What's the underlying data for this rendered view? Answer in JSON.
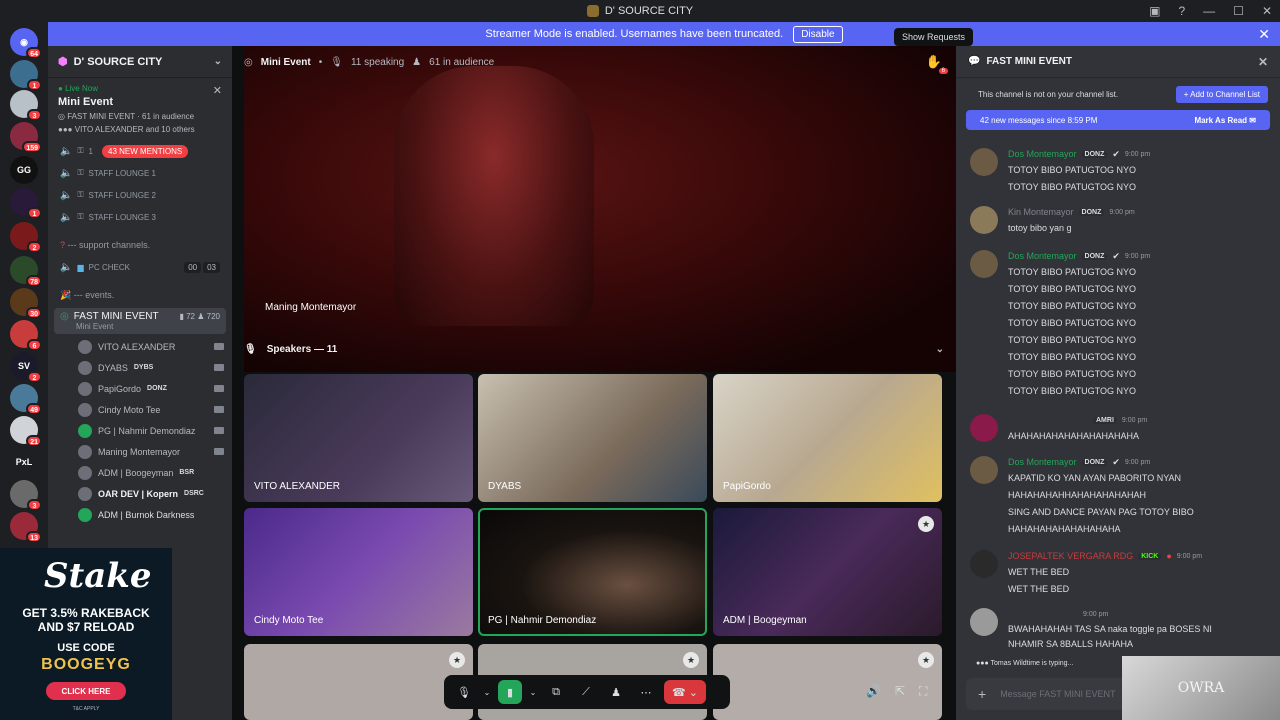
{
  "window": {
    "title": "D' SOURCE CITY"
  },
  "banner": {
    "text": "Streamer Mode is enabled. Usernames have been truncated.",
    "button": "Disable"
  },
  "tooltip": "Show Requests",
  "rail": {
    "guilds": [
      {
        "badge": "64",
        "text": ""
      },
      {
        "badge": "1",
        "text": ""
      },
      {
        "badge": "3",
        "text": ""
      },
      {
        "badge": "159",
        "text": ""
      },
      {
        "badge": "",
        "text": "GG"
      },
      {
        "badge": "1",
        "text": ""
      },
      {
        "badge": "2",
        "text": ""
      },
      {
        "badge": "78",
        "text": ""
      },
      {
        "badge": "30",
        "text": ""
      },
      {
        "badge": "6",
        "text": ""
      },
      {
        "badge": "2",
        "text": "SV"
      },
      {
        "badge": "49",
        "text": ""
      },
      {
        "badge": "21",
        "text": ""
      },
      {
        "badge": "",
        "text": "PxL"
      },
      {
        "badge": "3",
        "text": ""
      },
      {
        "badge": "13",
        "text": ""
      }
    ]
  },
  "sidebar": {
    "server_name": "D' SOURCE CITY",
    "live": {
      "status": "Live Now",
      "event": "Mini Event",
      "channel": "FAST MINI EVENT",
      "audience": "61 in audience",
      "attendees": "VITO ALEXANDER and 10 others"
    },
    "channels": [
      {
        "name": "1",
        "pill": "43 NEW MENTIONS"
      },
      {
        "name": "STAFF LOUNGE 1",
        "pill": ""
      },
      {
        "name": "STAFF LOUNGE 2",
        "pill": ""
      },
      {
        "name": "STAFF LOUNGE 3",
        "pill": ""
      }
    ],
    "support_category": "--- support channels.",
    "pc_check": {
      "name": "PC CHECK",
      "counts": [
        "00",
        "03"
      ]
    },
    "events_category": "--- events.",
    "stage_channel": {
      "name": "FAST MINI EVENT",
      "subtitle": "Mini Event",
      "cams": "72",
      "listeners": "720"
    },
    "members": [
      {
        "name": "VITO ALEXANDER",
        "tag": ""
      },
      {
        "name": "DYABS",
        "tag": "DYBS"
      },
      {
        "name": "PapiGordo",
        "tag": "DONZ"
      },
      {
        "name": "Cindy Moto Tee",
        "tag": ""
      },
      {
        "name": "PG | Nahmir Demondiaz",
        "tag": ""
      },
      {
        "name": "Maning Montemayor",
        "tag": ""
      },
      {
        "name": "ADM | Boogeyman",
        "tag": "BSR"
      },
      {
        "name": "OAR DEV | Kopern",
        "tag": "DSRC"
      },
      {
        "name": "ADM | Burnok Darkness",
        "tag": ""
      }
    ]
  },
  "ad": {
    "brand": "Stake",
    "line1": "GET 3.5% RAKEBACK",
    "line2": "AND $7 RELOAD",
    "line3": "USE CODE",
    "code": "BOOGEYG",
    "cta": "CLICK HERE",
    "fine": "T&C APPLY"
  },
  "stage": {
    "name": "Mini Event",
    "speaking": "11 speaking",
    "audience": "61 in audience",
    "hand_count": "6",
    "main_label": "Maning Montemayor",
    "speakers_label": "Speakers — 11",
    "tiles": [
      {
        "label": "VITO ALEXANDER"
      },
      {
        "label": "DYABS"
      },
      {
        "label": "PapiGordo"
      },
      {
        "label": "Cindy Moto Tee"
      },
      {
        "label": "PG | Nahmir Demondiaz"
      },
      {
        "label": "ADM | Boogeyman"
      },
      {
        "label": ""
      },
      {
        "label": ""
      },
      {
        "label": ""
      }
    ]
  },
  "chat": {
    "title": "FAST MINI EVENT",
    "notice": "This channel is not on your channel list.",
    "add_button": "Add to Channel List",
    "new_messages": "42 new messages since 8:59 PM",
    "mark_read": "Mark As Read",
    "messages": [
      {
        "name": "Dos Montemayor",
        "tag": "DONZ",
        "time": "9:00 pm",
        "style": "green",
        "lines": [
          "TOTOY BIBO PATUGTOG NYO",
          "TOTOY BIBO PATUGTOG NYO"
        ]
      },
      {
        "name": "Kin Montemayor",
        "tag": "DONZ",
        "time": "9:00 pm",
        "style": "dim",
        "lines": [
          "totoy bibo yan g"
        ]
      },
      {
        "name": "Dos Montemayor",
        "tag": "DONZ",
        "time": "9:00 pm",
        "style": "green",
        "lines": [
          "TOTOY BIBO PATUGTOG NYO",
          "TOTOY BIBO PATUGTOG NYO",
          "TOTOY BIBO PATUGTOG NYO",
          "TOTOY BIBO PATUGTOG NYO",
          "TOTOY BIBO PATUGTOG NYO",
          "TOTOY BIBO PATUGTOG NYO",
          "TOTOY BIBO PATUGTOG NYO",
          "TOTOY BIBO PATUGTOG NYO"
        ]
      },
      {
        "name": "",
        "tag": "AMRI",
        "time": "9:00 pm",
        "style": "dim",
        "lines": [
          "AHAHAHAHAHAHAHAHAHAHA"
        ]
      },
      {
        "name": "Dos Montemayor",
        "tag": "DONZ",
        "time": "9:00 pm",
        "style": "green",
        "lines": [
          "KAPATID KO YAN AYAN PABORITO NYAN",
          "HAHAHAHAHHAHAHAHAHAHAH",
          "SING AND DANCE PAYAN PAG TOTOY BIBO",
          "HAHAHAHAHAHAHAHAHA"
        ]
      },
      {
        "name": "JOSEPALTEK VERGARA RDG",
        "tag": "KICK",
        "time": "9:00 pm",
        "style": "red",
        "lines": [
          "WET THE BED",
          "WET THE BED"
        ]
      },
      {
        "name": "",
        "tag": "",
        "time": "9:00 pm",
        "style": "dim",
        "lines": [
          "BWAHAHAHAH TAS SA naka toggle pa BOSES NI",
          "NHAMIR SA 8BALLS HAHAHA"
        ]
      }
    ],
    "typing": "Tomas Wildtime is typing...",
    "composer_placeholder": "Message FAST MINI EVENT"
  },
  "webcam_text": "OWRA"
}
